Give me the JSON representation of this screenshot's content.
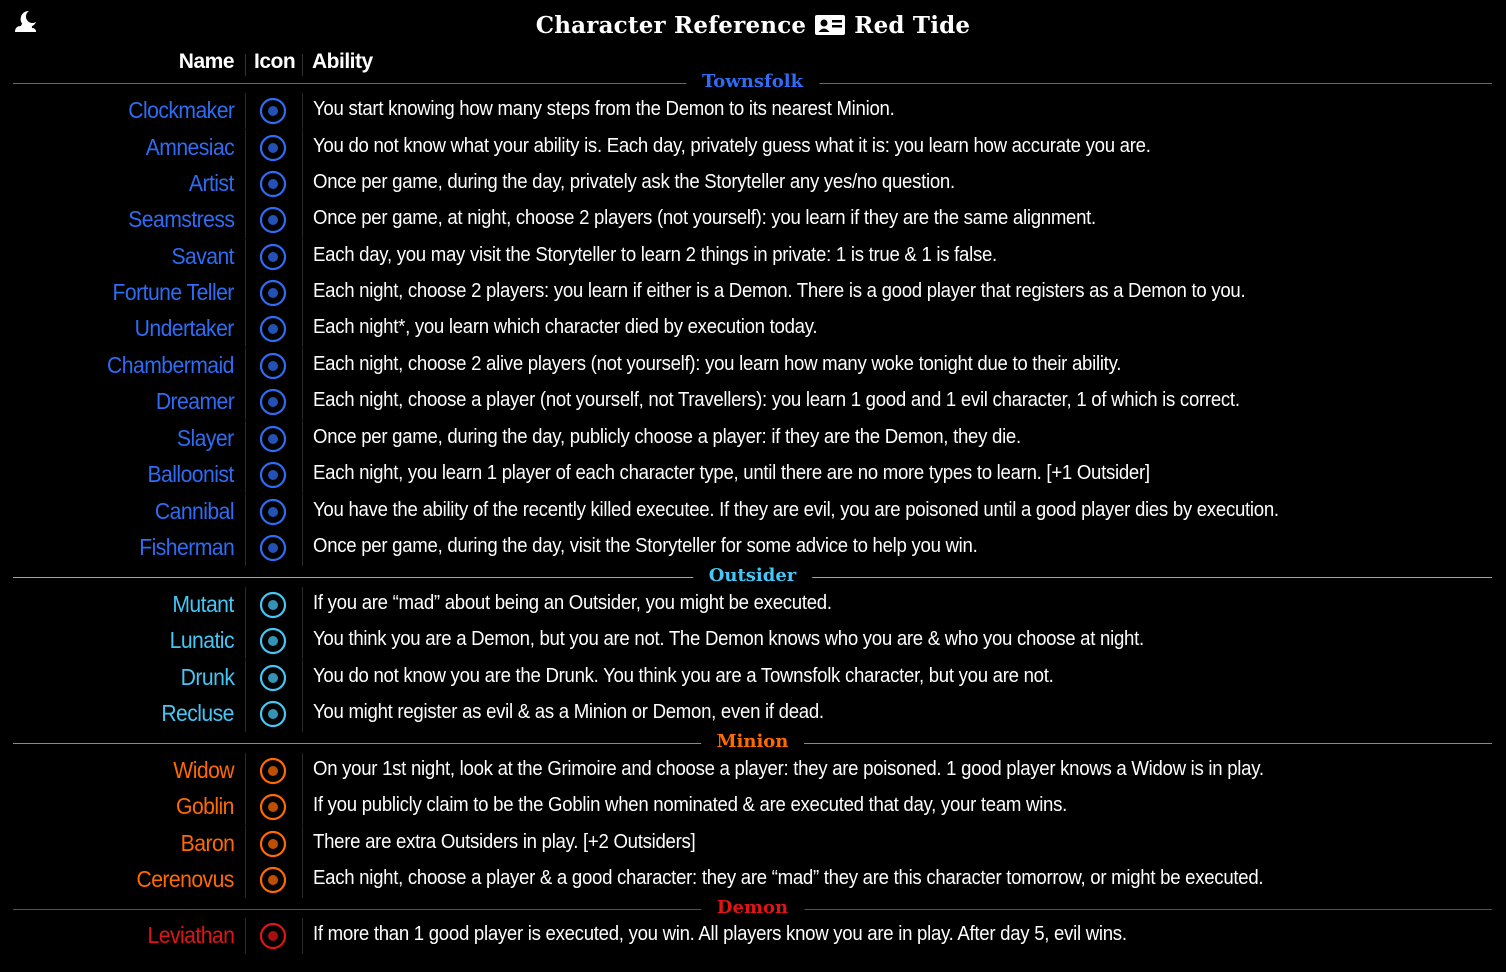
{
  "header": {
    "title_left": "Character Reference",
    "title_right": "Red Tide",
    "logo_icon": "moon-cloud-icon",
    "card_icon": "id-card-icon"
  },
  "columns": {
    "name": "Name",
    "icon": "Icon",
    "ability": "Ability"
  },
  "colors": {
    "townsfolk": "#2f6cf3",
    "outsider": "#45c6f5",
    "minion": "#ff6a00",
    "demon": "#e01414"
  },
  "sections": [
    {
      "label": "Townsfolk",
      "rows": [
        {
          "name": "Clockmaker",
          "icon": "clock-icon",
          "ability": "You start knowing how many steps from the Demon to its nearest Minion."
        },
        {
          "name": "Amnesiac",
          "icon": "question-mark-icon",
          "ability": "You do not know what your ability is. Each day, privately guess what it is: you learn how accurate you are."
        },
        {
          "name": "Artist",
          "icon": "paintbrush-icon",
          "ability": "Once per game, during the day, privately ask the Storyteller any yes/no question."
        },
        {
          "name": "Seamstress",
          "icon": "scissors-icon",
          "ability": "Once per game, at night, choose 2 players (not yourself): you learn if they are the same alignment."
        },
        {
          "name": "Savant",
          "icon": "wheelchair-icon",
          "ability": "Each day, you may visit the Storyteller to learn 2 things in private: 1 is true & 1 is false."
        },
        {
          "name": "Fortune Teller",
          "icon": "crystal-ball-icon",
          "ability": "Each night, choose 2 players: you learn if either is a Demon. There is a good player that registers as a Demon to you."
        },
        {
          "name": "Undertaker",
          "icon": "shovel-icon",
          "ability": "Each night*, you learn which character died by execution today."
        },
        {
          "name": "Chambermaid",
          "icon": "feather-duster-icon",
          "ability": "Each night, choose 2 alive players (not yourself): you learn how many woke tonight due to their ability."
        },
        {
          "name": "Dreamer",
          "icon": "dream-waves-icon",
          "ability": "Each night, choose a player (not yourself, not Travellers): you learn 1 good and 1 evil character, 1 of which is correct."
        },
        {
          "name": "Slayer",
          "icon": "crossbow-icon",
          "ability": "Once per game, during the day, publicly choose a player: if they are the Demon, they die."
        },
        {
          "name": "Balloonist",
          "icon": "balloon-icon",
          "ability": "Each night, you learn 1 player of each character type, until there are no more types to learn. [+1 Outsider]"
        },
        {
          "name": "Cannibal",
          "icon": "platter-icon",
          "ability": "You have the ability of the recently killed executee. If they are evil, you are poisoned until a good player dies by execution."
        },
        {
          "name": "Fisherman",
          "icon": "fish-icon",
          "ability": "Once per game, during the day, visit the Storyteller for some advice to help you win."
        }
      ]
    },
    {
      "label": "Outsider",
      "rows": [
        {
          "name": "Mutant",
          "icon": "tent-icon",
          "ability": "If you are “mad” about being an Outsider, you might be executed."
        },
        {
          "name": "Lunatic",
          "icon": "spiral-icon",
          "ability": "You think you are a Demon, but you are not. The Demon knows who you are & who you choose at night."
        },
        {
          "name": "Drunk",
          "icon": "tankard-icon",
          "ability": "You do not know you are the Drunk. You think you are a Townsfolk character, but you are not."
        },
        {
          "name": "Recluse",
          "icon": "lantern-icon",
          "ability": "You might register as evil & as a Minion or Demon, even if dead."
        }
      ]
    },
    {
      "label": "Minion",
      "rows": [
        {
          "name": "Widow",
          "icon": "spider-icon",
          "ability": "On your 1st night, look at the Grimoire and choose a player: they are poisoned. 1 good player knows a Widow is in play."
        },
        {
          "name": "Goblin",
          "icon": "grin-icon",
          "ability": "If you publicly claim to be the Goblin when nominated & are executed that day, your team wins."
        },
        {
          "name": "Baron",
          "icon": "top-hat-icon",
          "ability": "There are extra Outsiders in play. [+2 Outsiders]"
        },
        {
          "name": "Cerenovus",
          "icon": "brain-icon",
          "ability": "Each night, choose a player & a good character: they are “mad” they are this character tomorrow, or might be executed."
        }
      ]
    },
    {
      "label": "Demon",
      "rows": [
        {
          "name": "Leviathan",
          "icon": "tentacles-icon",
          "ability": "If more than 1 good player is executed, you win. All players know you are in play. After day 5, evil wins."
        }
      ]
    }
  ]
}
